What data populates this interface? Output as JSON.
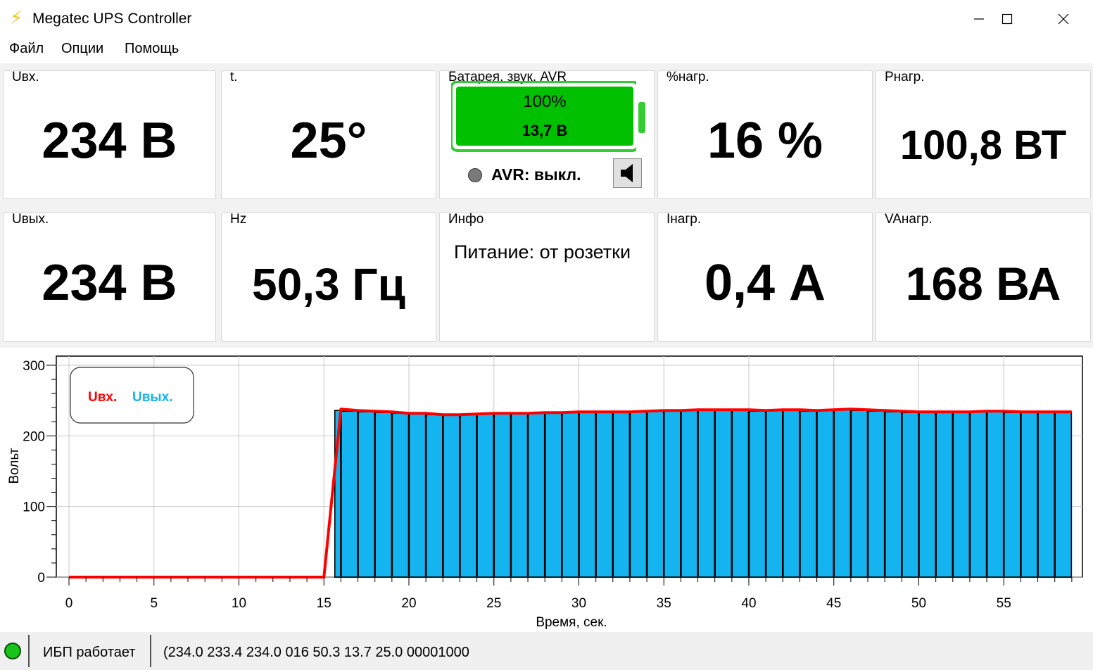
{
  "window": {
    "title": "Megatec UPS Controller"
  },
  "menu": {
    "items": [
      "Файл",
      "Опции",
      "Помощь"
    ]
  },
  "panels": {
    "uin": {
      "label": "Uвх.",
      "value": "234 В"
    },
    "temp": {
      "label": "t.",
      "value": "25°"
    },
    "battery": {
      "label": "Батарея, звук, AVR",
      "percent_text": "100%",
      "voltage_text": "13,7 В",
      "charge_fraction": 1.0,
      "avr_text": "AVR: выкл."
    },
    "load_pct": {
      "label": "%нагр.",
      "value": "16 %"
    },
    "power": {
      "label": "Pнагр.",
      "value": "100,8 ВТ"
    },
    "uout": {
      "label": "Uвых.",
      "value": "234 В"
    },
    "freq": {
      "label": "Hz",
      "value": "50,3 Гц"
    },
    "info": {
      "label": "Инфо",
      "text": "Питание: от розетки"
    },
    "current": {
      "label": "Iнагр.",
      "value": "0,4 А"
    },
    "va": {
      "label": "VAнагр.",
      "value": "168 ВА"
    }
  },
  "colors": {
    "battery_fill": "#00c000",
    "battery_border": "#33cc33",
    "uin_line": "#ff0000",
    "uout_bar": "#14b4f0",
    "status_led": "#19c419"
  },
  "chart_data": {
    "type": "bar",
    "xlabel": "Время, сек.",
    "ylabel": "Вольт",
    "xlim": [
      0,
      59
    ],
    "ylim": [
      0,
      300
    ],
    "x_ticks": [
      0,
      5,
      10,
      15,
      20,
      25,
      30,
      35,
      40,
      45,
      50,
      55
    ],
    "y_ticks": [
      0,
      100,
      200,
      300
    ],
    "grid": true,
    "legend_position": "top-left",
    "series": [
      {
        "name": "Uвх.",
        "kind": "line",
        "x": [
          0,
          1,
          2,
          3,
          4,
          5,
          6,
          7,
          8,
          9,
          10,
          11,
          12,
          13,
          14,
          15,
          16,
          17,
          18,
          19,
          20,
          21,
          22,
          23,
          24,
          25,
          26,
          27,
          28,
          29,
          30,
          31,
          32,
          33,
          34,
          35,
          36,
          37,
          38,
          39,
          40,
          41,
          42,
          43,
          44,
          45,
          46,
          47,
          48,
          49,
          50,
          51,
          52,
          53,
          54,
          55,
          56,
          57,
          58,
          59
        ],
        "values": [
          0,
          0,
          0,
          0,
          0,
          0,
          0,
          0,
          0,
          0,
          0,
          0,
          0,
          0,
          0,
          0,
          238,
          236,
          235,
          234,
          232,
          232,
          230,
          230,
          231,
          232,
          232,
          232,
          233,
          233,
          234,
          234,
          234,
          234,
          235,
          236,
          236,
          237,
          237,
          237,
          237,
          236,
          237,
          237,
          236,
          237,
          238,
          237,
          236,
          235,
          234,
          234,
          234,
          234,
          235,
          235,
          234,
          234,
          234,
          234
        ]
      },
      {
        "name": "Uвых.",
        "kind": "bar",
        "x": [
          16,
          17,
          18,
          19,
          20,
          21,
          22,
          23,
          24,
          25,
          26,
          27,
          28,
          29,
          30,
          31,
          32,
          33,
          34,
          35,
          36,
          37,
          38,
          39,
          40,
          41,
          42,
          43,
          44,
          45,
          46,
          47,
          48,
          49,
          50,
          51,
          52,
          53,
          54,
          55,
          56,
          57,
          58,
          59
        ],
        "values": [
          236,
          235,
          234,
          233,
          232,
          231,
          230,
          230,
          231,
          231,
          231,
          231,
          232,
          232,
          233,
          233,
          233,
          233,
          234,
          235,
          235,
          236,
          236,
          236,
          236,
          235,
          236,
          236,
          235,
          236,
          237,
          236,
          235,
          234,
          233,
          233,
          233,
          233,
          234,
          234,
          233,
          233,
          233,
          233
        ]
      }
    ]
  },
  "status": {
    "state_text": "ИБП работает",
    "raw_text": "(234.0 233.4 234.0 016 50.3 13.7 25.0 00001000"
  }
}
